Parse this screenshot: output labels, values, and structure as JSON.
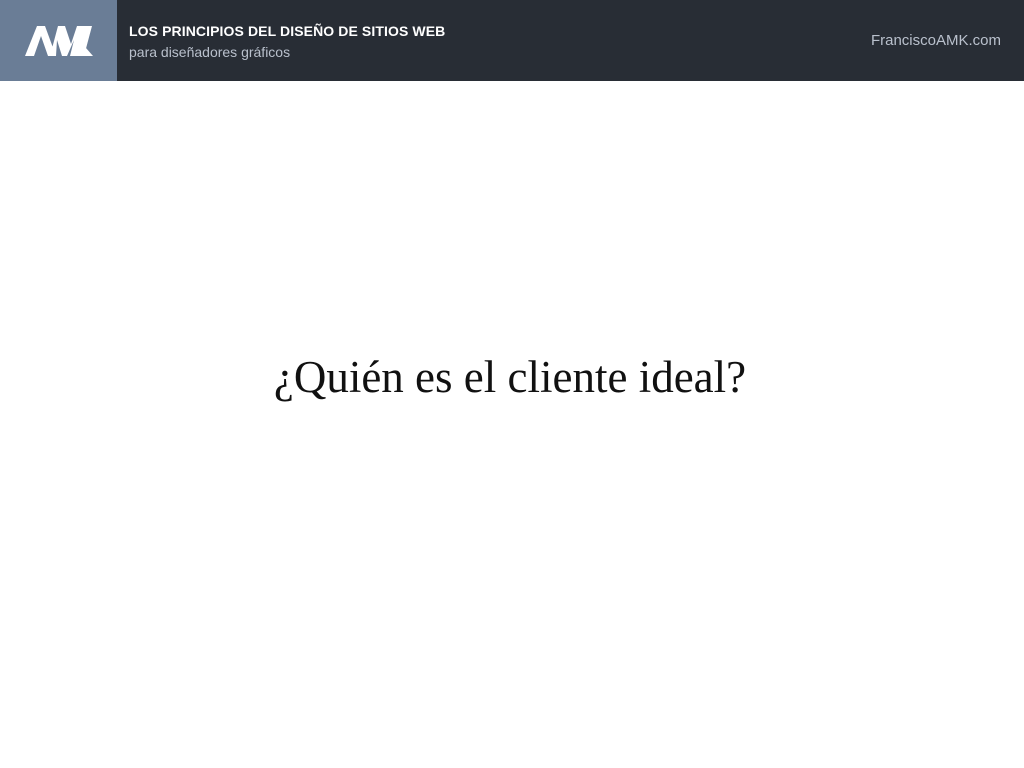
{
  "header": {
    "logo_text": "AMK",
    "course_title": "LOS PRINCIPIOS DEL DISEÑO DE SITIOS WEB",
    "course_subtitle": "para diseñadores gráficos",
    "site_link": "FranciscoAMK.com"
  },
  "slide": {
    "question": "¿Quién es el cliente ideal?"
  },
  "colors": {
    "header_background": "#282d35",
    "logo_background": "#6a7d96",
    "slide_background": "#ffffff",
    "text_dark": "#111111",
    "text_muted": "#b9c0cc"
  }
}
